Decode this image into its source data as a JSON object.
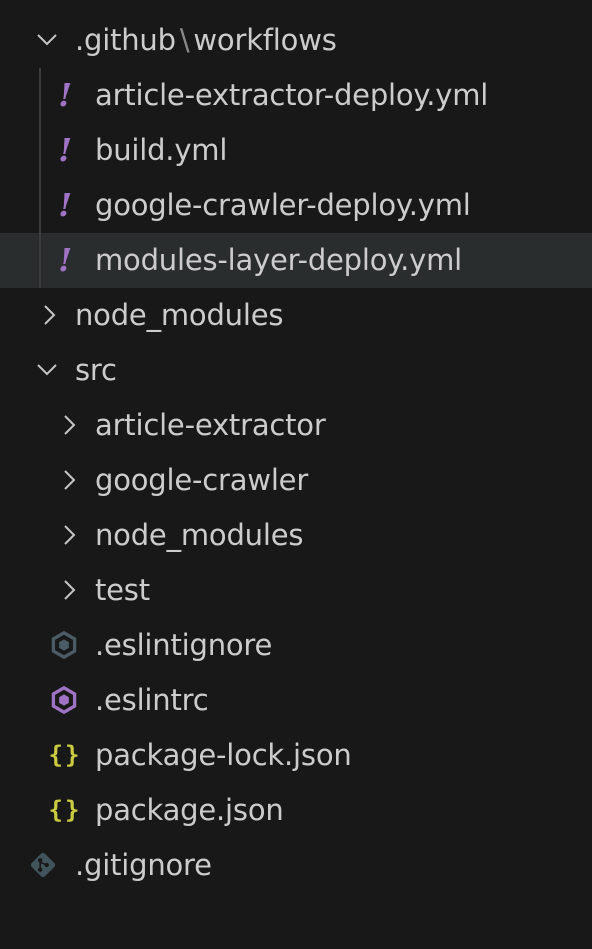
{
  "explorer": {
    "workflows_folder": {
      "segment_1": ".github",
      "separator": "\\",
      "segment_2": "workflows",
      "icon": "chevron-down-icon",
      "files": [
        {
          "label": "article-extractor-deploy.yml",
          "icon": "yaml-exclamation-icon"
        },
        {
          "label": "build.yml",
          "icon": "yaml-exclamation-icon"
        },
        {
          "label": "google-crawler-deploy.yml",
          "icon": "yaml-exclamation-icon"
        },
        {
          "label": "modules-layer-deploy.yml",
          "icon": "yaml-exclamation-icon",
          "hovered": true
        }
      ]
    },
    "node_modules_folder": {
      "label": "node_modules",
      "icon": "chevron-right-icon"
    },
    "src_folder": {
      "label": "src",
      "icon": "chevron-down-icon",
      "children": [
        {
          "label": "article-extractor",
          "icon": "chevron-right-icon"
        },
        {
          "label": "google-crawler",
          "icon": "chevron-right-icon"
        },
        {
          "label": "node_modules",
          "icon": "chevron-right-icon"
        },
        {
          "label": "test",
          "icon": "chevron-right-icon"
        }
      ],
      "files": [
        {
          "label": ".eslintignore",
          "icon": "eslint-icon",
          "color": "#4b5c66"
        },
        {
          "label": ".eslintrc",
          "icon": "eslint-icon",
          "color": "#a074c4"
        },
        {
          "label": "package-lock.json",
          "icon": "json-braces-icon",
          "color": "#cbcb41"
        },
        {
          "label": "package.json",
          "icon": "json-braces-icon",
          "color": "#cbcb41"
        }
      ]
    },
    "root_files": [
      {
        "label": ".gitignore",
        "icon": "git-icon",
        "color": "#41535b"
      }
    ]
  }
}
